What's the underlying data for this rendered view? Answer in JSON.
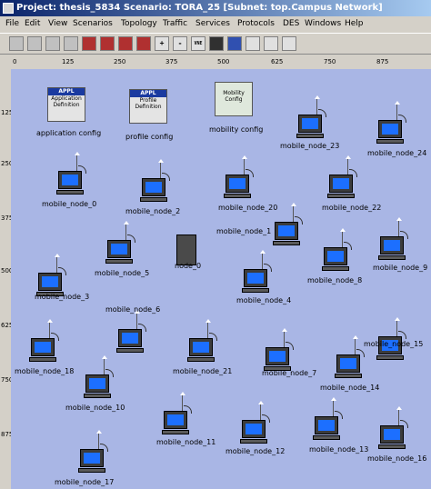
{
  "window": {
    "title": "Project: thesis_5834 Scenario: TORA_25  [Subnet: top.Campus Network]"
  },
  "menu": [
    "File",
    "Edit",
    "View",
    "Scenarios",
    "Topology",
    "Traffic",
    "Services",
    "Protocols",
    "DES",
    "Windows",
    "Help"
  ],
  "toolbar": [
    {
      "name": "open-icon"
    },
    {
      "name": "save-icon"
    },
    {
      "name": "folder-icon"
    },
    {
      "name": "print-icon"
    },
    {
      "name": "object-palette-icon"
    },
    {
      "name": "failure-icon"
    },
    {
      "name": "recover-icon"
    },
    {
      "name": "mark-icon"
    },
    {
      "name": "zoom-in-icon"
    },
    {
      "name": "zoom-out-icon"
    },
    {
      "name": "vne-icon"
    },
    {
      "name": "traffic-light-icon"
    },
    {
      "name": "triangle-icon"
    },
    {
      "name": "view-results-icon"
    },
    {
      "name": "chart-icon"
    },
    {
      "name": "hide-graphs-icon"
    }
  ],
  "ruler_x": [
    "0",
    "125",
    "250",
    "375",
    "500",
    "625",
    "750",
    "875"
  ],
  "ruler_y": [
    "125",
    "250",
    "375",
    "500",
    "625",
    "750",
    "875"
  ],
  "configs": [
    {
      "cap": "APPL",
      "inner": "Application Definition",
      "label": "application config"
    },
    {
      "cap": "APPL",
      "inner": "Profile Definition",
      "label": "profile config"
    },
    {
      "cap": "",
      "inner": "Mobility Config",
      "label": "mobility config"
    }
  ],
  "server": {
    "label": "node_0"
  },
  "nodes": [
    "mobile_node_23",
    "mobile_node_24",
    "mobile_node_0",
    "mobile_node_2",
    "mobile_node_20",
    "mobile_node_22",
    "mobile_node_1",
    "mobile_node_5",
    "mobile_node_8",
    "mobile_node_9",
    "mobile_node_3",
    "mobile_node_4",
    "mobile_node_6",
    "mobile_node_18",
    "mobile_node_21",
    "mobile_node_7",
    "mobile_node_15",
    "mobile_node_10",
    "mobile_node_14",
    "mobile_node_11",
    "mobile_node_12",
    "mobile_node_13",
    "mobile_node_16",
    "mobile_node_17"
  ]
}
